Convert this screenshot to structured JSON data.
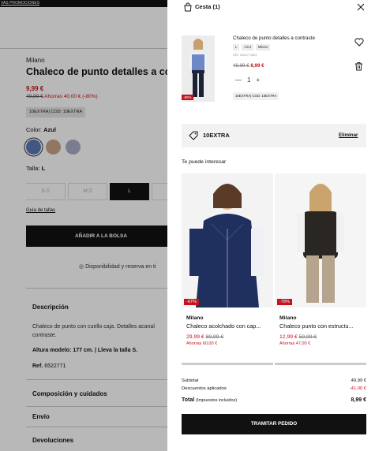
{
  "topbar": {
    "promo_link": "VAS PROMOCIONES"
  },
  "product": {
    "brand": "Milano",
    "title": "Chaleco de punto detalles a contraste",
    "price": "9,99 €",
    "old_price": "49,99 €",
    "savings": "Ahorras 40,00 € (-80%)",
    "promo_code": "10EXTRA| COD: 10EXTRA",
    "color_label": "Color:",
    "color_value": "Azul",
    "colors": [
      "#5b78b5",
      "#c9a48b",
      "#a9adc7"
    ],
    "size_label": "Talla:",
    "size_value": "L",
    "sizes": [
      "S",
      "M",
      "L"
    ],
    "size_guide": "Guía de tallas",
    "add_button": "AÑADIR A LA BOLSA",
    "availability": "Disponibilidad y reserva en ti",
    "description_heading": "Descripción",
    "description_text": "Chaleco de punto con cuello caja. Detalles acanal contraste.",
    "model_height": "Altura modelo: 177 cm.  |  Lleva la talla S.",
    "ref_label": "Ref.",
    "ref_value": "6522771",
    "sections": [
      "Composición y cuidados",
      "Envío",
      "Devoluciones"
    ]
  },
  "cart": {
    "title": "Cesta (1)",
    "item": {
      "name": "Chaleco de punto detalles a contraste",
      "chips": [
        "L",
        "Azul",
        "Milano"
      ],
      "ref": "REF. 6522771804",
      "old_price": "49,99 €",
      "price": "8,99 €",
      "quantity": "1",
      "badge": "-80%",
      "promo": "10EXTRA| COD: 10EXTRA"
    },
    "code": {
      "label": "10EXTRA",
      "remove": "Eliminar"
    },
    "interest_heading": "Te puede interesar",
    "recommendations": [
      {
        "badge": "-67%",
        "brand": "Milano",
        "name": "Chaleco acolchado con cap...",
        "price": "29,99 €",
        "old_price": "89,99 €",
        "savings": "Ahorras 60,00 €"
      },
      {
        "badge": "-78%",
        "brand": "Milano",
        "name": "Chaleco punto con estructu...",
        "price": "12,99 €",
        "old_price": "59,99 €",
        "savings": "Ahorras 47,00 €"
      }
    ],
    "totals": {
      "subtotal_label": "Subtotal",
      "subtotal_value": "49,99 €",
      "discount_label": "Descuentos aplicados",
      "discount_value": "-41,00 €",
      "total_label": "Total",
      "total_note": "(Impuestos incluidos)",
      "total_value": "8,99 €"
    },
    "checkout_button": "TRAMITAR PEDIDO"
  },
  "colors": {
    "accent_red": "#c2131f",
    "dark": "#111111",
    "overlay": "rgba(0,0,0,0.28)"
  }
}
